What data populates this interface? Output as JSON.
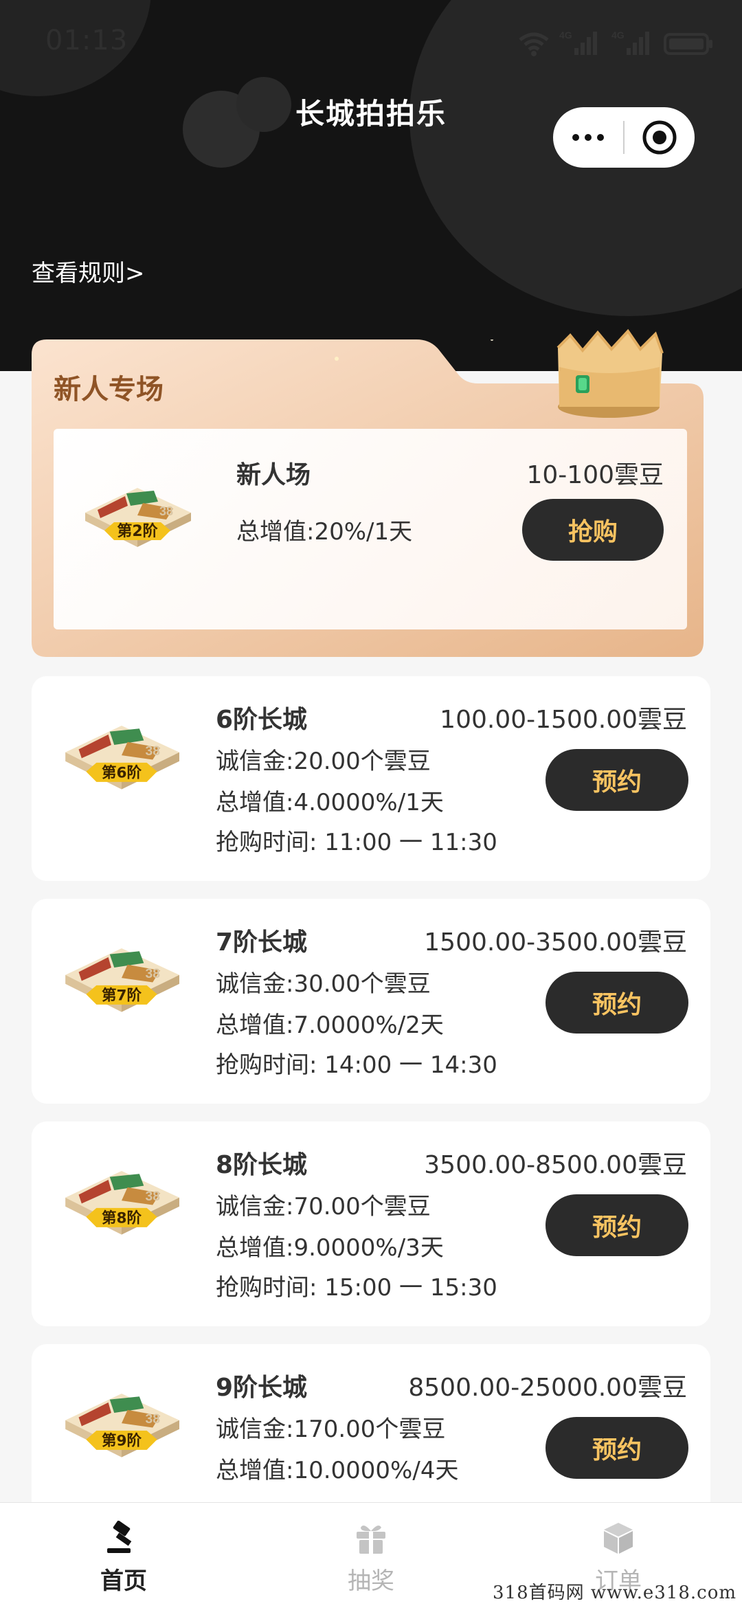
{
  "status_bar": {
    "time": "01:13",
    "network_1": "4G",
    "network_2": "4G"
  },
  "header": {
    "title": "长城拍拍乐",
    "rules_link": "查看规则>"
  },
  "newbie_section": {
    "title": "新人专场",
    "card": {
      "badge": "第2阶",
      "name": "新人场",
      "range": "10-100雲豆",
      "rate": "总增值:20%/1天",
      "button": "抢购"
    }
  },
  "levels": [
    {
      "badge": "第6阶",
      "name": "6阶长城",
      "range": "100.00-1500.00雲豆",
      "deposit": "诚信金:20.00个雲豆",
      "rate": "总增值:4.0000%/1天",
      "time": "抢购时间: 11:00 一 11:30",
      "button": "预约"
    },
    {
      "badge": "第7阶",
      "name": "7阶长城",
      "range": "1500.00-3500.00雲豆",
      "deposit": "诚信金:30.00个雲豆",
      "rate": "总增值:7.0000%/2天",
      "time": "抢购时间: 14:00 一 14:30",
      "button": "预约"
    },
    {
      "badge": "第8阶",
      "name": "8阶长城",
      "range": "3500.00-8500.00雲豆",
      "deposit": "诚信金:70.00个雲豆",
      "rate": "总增值:9.0000%/3天",
      "time": "抢购时间: 15:00 一 15:30",
      "button": "预约"
    },
    {
      "badge": "第9阶",
      "name": "9阶长城",
      "range": "8500.00-25000.00雲豆",
      "deposit": "诚信金:170.00个雲豆",
      "rate": "总增值:10.0000%/4天",
      "button": "预约"
    }
  ],
  "tabbar": {
    "items": [
      {
        "label": "首页",
        "icon": "auction-hammer-icon",
        "active": true
      },
      {
        "label": "抽奖",
        "icon": "gift-icon",
        "active": false
      },
      {
        "label": "订单",
        "icon": "box-icon",
        "active": false
      }
    ]
  },
  "watermark": "318首码网 www.e318.com",
  "colors": {
    "header_bg": "#141414",
    "button_bg": "#2b2b2b",
    "button_text": "#f8c361",
    "newbie_title": "#8f5426"
  }
}
